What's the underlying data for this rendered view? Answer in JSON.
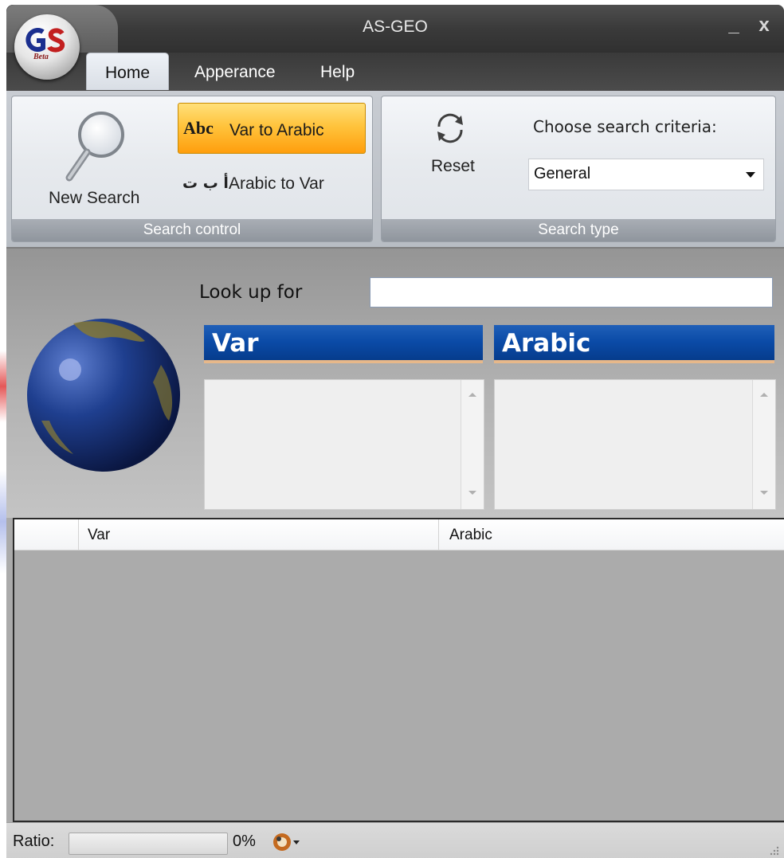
{
  "window": {
    "title": "AS-GEO",
    "minimize_glyph": "_",
    "close_glyph": "x",
    "logo_text": "Beta"
  },
  "tabs": [
    {
      "label": "Home",
      "active": true
    },
    {
      "label": "Apperance",
      "active": false
    },
    {
      "label": "Help",
      "active": false
    }
  ],
  "ribbon": {
    "search_control": {
      "group_label": "Search control",
      "new_search_label": "New Search",
      "var_to_arabic": {
        "icon_text": "Abc",
        "label": "Var to Arabic",
        "active": true
      },
      "arabic_to_var": {
        "icon_text": "أ ب ت",
        "label": "Arabic to Var"
      }
    },
    "search_type": {
      "group_label": "Search type",
      "reset_label": "Reset",
      "criteria_label": "Choose search criteria:",
      "criteria_value": "General"
    }
  },
  "lookup": {
    "label": "Look up for",
    "value": "",
    "var_header": "Var",
    "arabic_header": "Arabic"
  },
  "grid": {
    "columns": [
      "Var",
      "Arabic"
    ]
  },
  "status": {
    "ratio_label": "Ratio:",
    "percent_text": "0%",
    "progress_value": 0
  },
  "colors": {
    "accent_orange": "#ffc43d",
    "header_blue": "#0a4aa6",
    "titlebar": "#3a3a3a"
  }
}
